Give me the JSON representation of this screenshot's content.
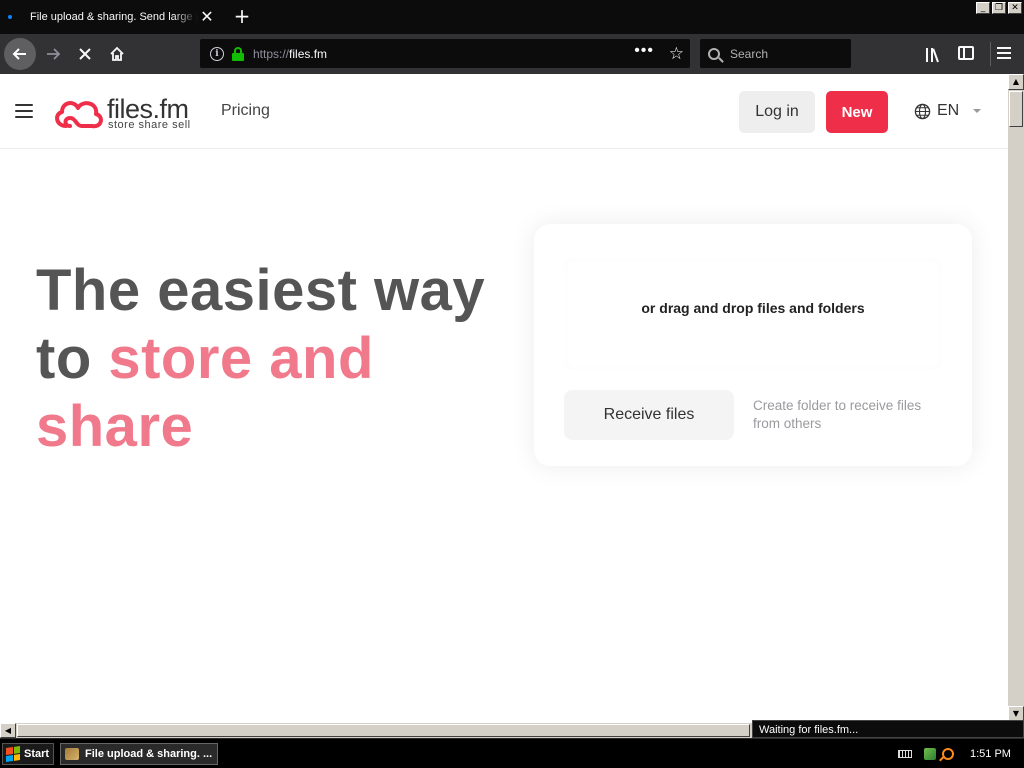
{
  "browser": {
    "tab_title": "File upload & sharing. Send large p",
    "tab_close": "✕",
    "new_tab": "+",
    "url_scheme": "https://",
    "url_host": "files.fm",
    "url_dots": "•••",
    "search_placeholder": "Search",
    "status": "Waiting for files.fm..."
  },
  "site": {
    "logo_name": "files.fm",
    "logo_tagline": "store share sell",
    "nav_pricing": "Pricing",
    "login_label": "Log in",
    "new_label": "New",
    "language": "EN",
    "brand_color": "#ef2e49"
  },
  "hero": {
    "line1": "The easiest way",
    "line2_plain": "to ",
    "line2_accent": "store and",
    "line3_accent": "share"
  },
  "upload": {
    "drop_text": "or drag and drop files and folders",
    "receive_label": "Receive files",
    "receive_hint": "Create folder to receive files from others"
  },
  "taskbar": {
    "start_label": "Start",
    "task_label": "File upload & sharing. ...",
    "clock": "1:51 PM"
  }
}
